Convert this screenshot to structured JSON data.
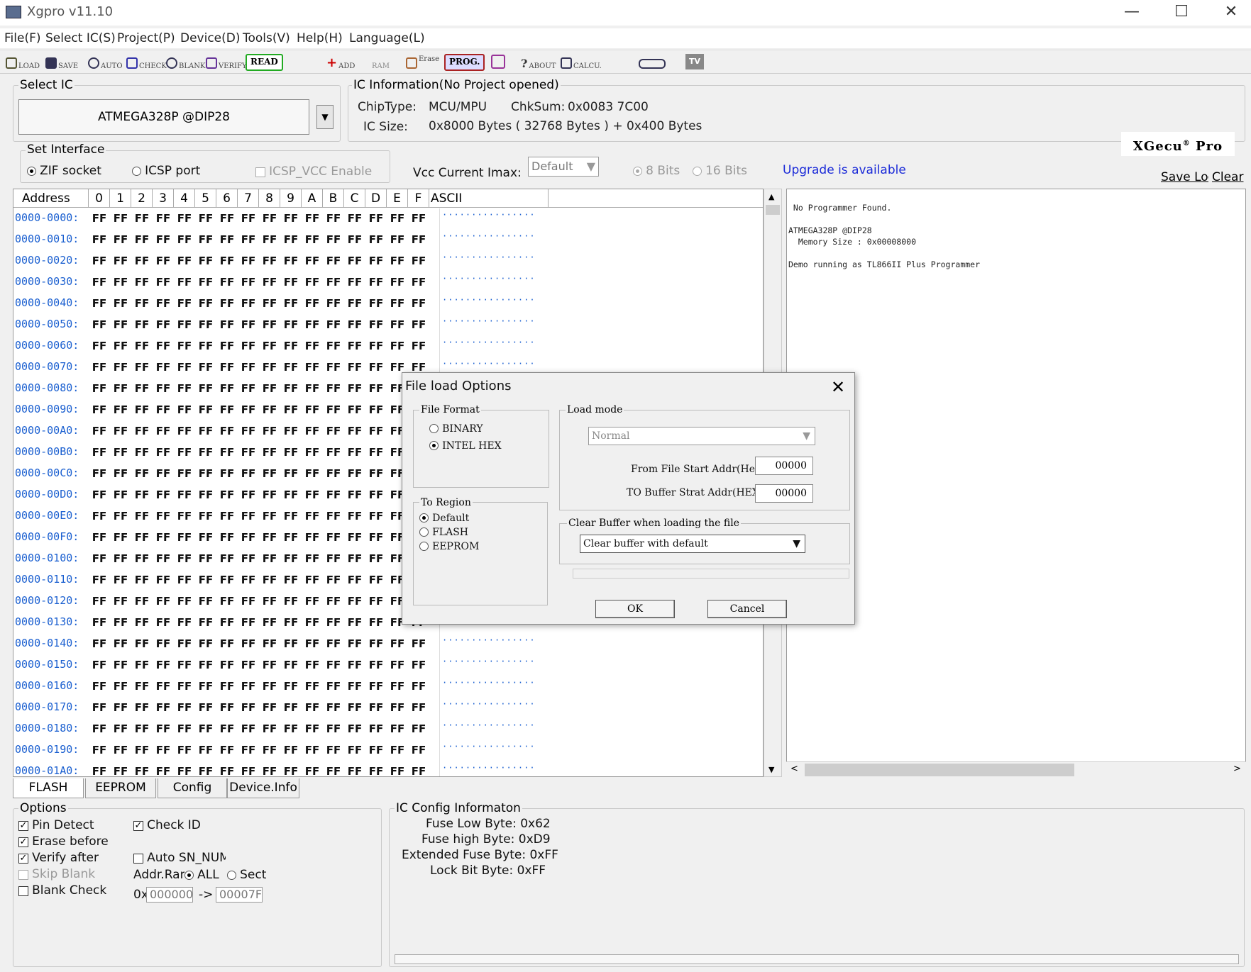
{
  "window": {
    "title": "Xgpro v11.10",
    "minimize_glyph": "—",
    "maximize_glyph": "☐",
    "close_glyph": "✕"
  },
  "menu": [
    "File(F)",
    "Select IC(S)",
    "Project(P)",
    "Device(D)",
    "Tools(V)",
    "Help(H)",
    "Language(L)"
  ],
  "toolbar": {
    "load": "LOAD",
    "save": "SAVE",
    "auto": "AUTO",
    "check": "CHECK",
    "blank": "BLANK",
    "verify": "VERIFY",
    "read": "READ",
    "add": "ADD",
    "ram": "RAM",
    "erase": "Erase",
    "prog": "PROG.",
    "about": "ABOUT",
    "calcu": "CALCU.",
    "tv": "TV"
  },
  "select_ic": {
    "label": "Select IC",
    "value": "ATMEGA328P @DIP28"
  },
  "ic_info": {
    "label": "IC Information(No Project opened)",
    "chiptype_label": "ChipType:",
    "chiptype_value": "MCU/MPU",
    "chksum_label": "ChkSum:",
    "chksum_value": "0x0083 7C00",
    "icsize_label": "IC Size:",
    "icsize_value": "0x8000 Bytes ( 32768 Bytes ) + 0x400 Bytes"
  },
  "brand": {
    "name": "XGecu",
    "sup": "®",
    "suffix": "Pro"
  },
  "interface": {
    "label": "Set Interface",
    "zif": "ZIF socket",
    "icsp": "ICSP port",
    "icsp_vcc": "ICSP_VCC Enable",
    "vcc_label": "Vcc Current Imax:",
    "vcc_value": "Default",
    "bits8": "8 Bits",
    "bits16": "16 Bits",
    "upgrade": "Upgrade is available"
  },
  "log": {
    "save_label": "Save Log",
    "clear_label": "Clear",
    "text": " No Programmer Found.\n\nATMEGA328P @DIP28\n  Memory Size : 0x00008000\n\nDemo running as TL866II Plus Programmer"
  },
  "hex": {
    "address_header": "Address",
    "ascii_header": "ASCII",
    "columns": [
      "0",
      "1",
      "2",
      "3",
      "4",
      "5",
      "6",
      "7",
      "8",
      "9",
      "A",
      "B",
      "C",
      "D",
      "E",
      "F"
    ],
    "fill_byte": "FF",
    "ascii_fill": "················",
    "rows": [
      "0000-0000:",
      "0000-0010:",
      "0000-0020:",
      "0000-0030:",
      "0000-0040:",
      "0000-0050:",
      "0000-0060:",
      "0000-0070:",
      "0000-0080:",
      "0000-0090:",
      "0000-00A0:",
      "0000-00B0:",
      "0000-00C0:",
      "0000-00D0:",
      "0000-00E0:",
      "0000-00F0:",
      "0000-0100:",
      "0000-0110:",
      "0000-0120:",
      "0000-0130:",
      "0000-0140:",
      "0000-0150:",
      "0000-0160:",
      "0000-0170:",
      "0000-0180:",
      "0000-0190:",
      "0000-01A0:"
    ]
  },
  "tabs": [
    "FLASH",
    "EEPROM",
    "Config",
    "Device.Info"
  ],
  "options": {
    "label": "Options",
    "pin_detect": "Pin Detect",
    "erase_before": "Erase before",
    "verify_after": "Verify after",
    "skip_blank": "Skip Blank",
    "blank_check": "Blank Check",
    "check_id": "Check ID",
    "auto_sn": "Auto SN_NUM",
    "addr_range": "Addr.Range",
    "all": "ALL",
    "sect": "Sect",
    "addr_prefix": "0x",
    "addr_from": "000000",
    "arrow": "->",
    "addr_to": "00007F"
  },
  "ic_config": {
    "label": "IC Config Informaton",
    "lines": [
      "Fuse Low Byte: 0x62",
      "Fuse high Byte: 0xD9",
      "Extended Fuse Byte: 0xFF",
      "Lock Bit Byte: 0xFF"
    ]
  },
  "dialog": {
    "title": "File load Options",
    "file_format_label": "File Format",
    "binary": "BINARY",
    "intel_hex": "INTEL HEX",
    "to_region_label": "To Region",
    "region_default": "Default",
    "region_flash": "FLASH",
    "region_eeprom": "EEPROM",
    "load_mode_label": "Load mode",
    "load_mode_value": "Normal",
    "from_file_label": "From File Start Addr(Hex):",
    "from_file_value": "00000",
    "to_buffer_label": "TO Buffer Strat Addr(HEX):",
    "to_buffer_value": "00000",
    "clear_buffer_label": "Clear Buffer when loading the file",
    "clear_buffer_value": "Clear buffer with default",
    "ok": "OK",
    "cancel": "Cancel"
  }
}
